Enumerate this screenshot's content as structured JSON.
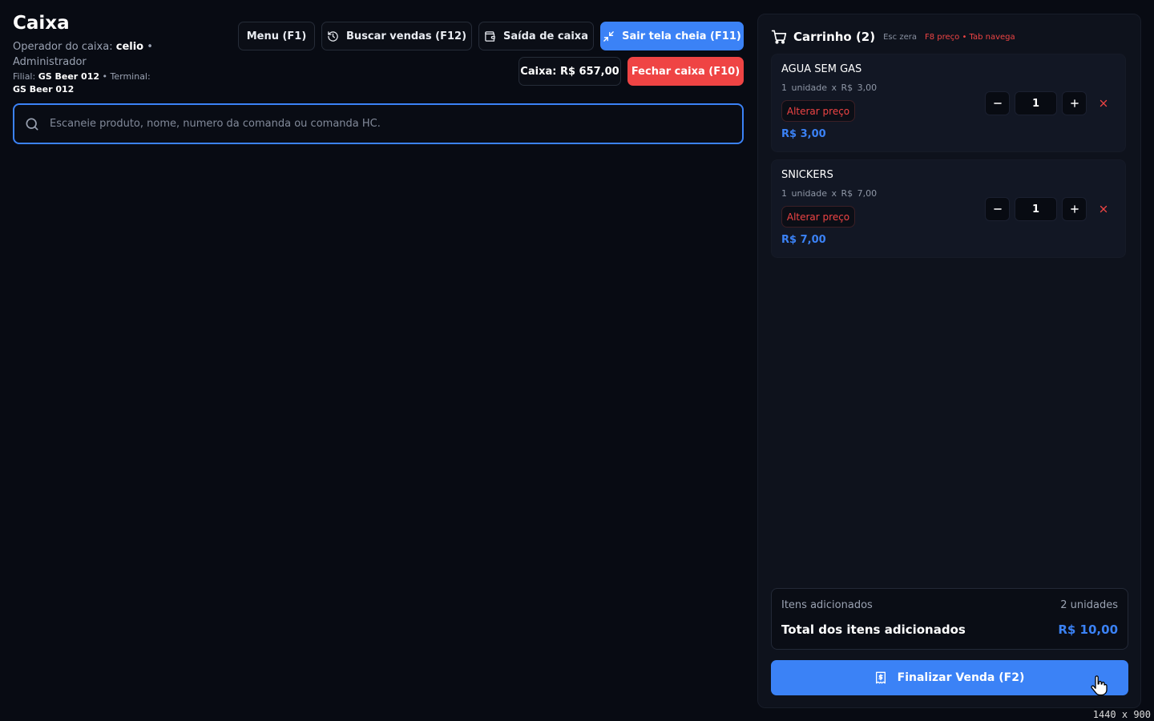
{
  "header": {
    "title": "Caixa",
    "operator_label": "Operador do caixa:",
    "operator_name": "celio",
    "operator_role": "Administrador",
    "filial_label": "Filial:",
    "filial_value": "GS Beer 012",
    "terminal_label": "Terminal:",
    "terminal_value": "GS Beer 012"
  },
  "toolbar": {
    "menu_label": "Menu  (F1)",
    "buscar_label": "Buscar vendas  (F12)",
    "saida_label": "Saída de caixa",
    "fullscreen_label": "Sair tela cheia (F11)",
    "cash_label": "Caixa: R$ 657,00",
    "fechar_label": "Fechar caixa  (F10)"
  },
  "search": {
    "placeholder": "Escaneie produto, nome, numero da comanda ou comanda HC.",
    "value": ""
  },
  "cart": {
    "title": "Carrinho (2)",
    "hint_esc": "Esc zera",
    "hint_keys": "F8 preço • Tab navega",
    "alter_label": "Alterar preço",
    "items": [
      {
        "name": "AGUA SEM GAS",
        "detail": "1 unidade  x R$ 3,00",
        "price": "R$ 3,00",
        "qty": "1"
      },
      {
        "name": "SNICKERS",
        "detail": "1 unidade  x R$ 7,00",
        "price": "R$ 7,00",
        "qty": "1"
      }
    ],
    "summary": {
      "items_label": "Itens adicionados",
      "items_count": "2 unidades",
      "total_label": "Total dos itens adicionados",
      "total_value": "R$ 10,00"
    },
    "finalize_label": "Finalizar Venda (F2)"
  },
  "screen_dims": "1440 x 900",
  "colors": {
    "background": "#080b13",
    "accent": "#3b82f6",
    "danger": "#ef4444",
    "panel": "#0e121c"
  }
}
